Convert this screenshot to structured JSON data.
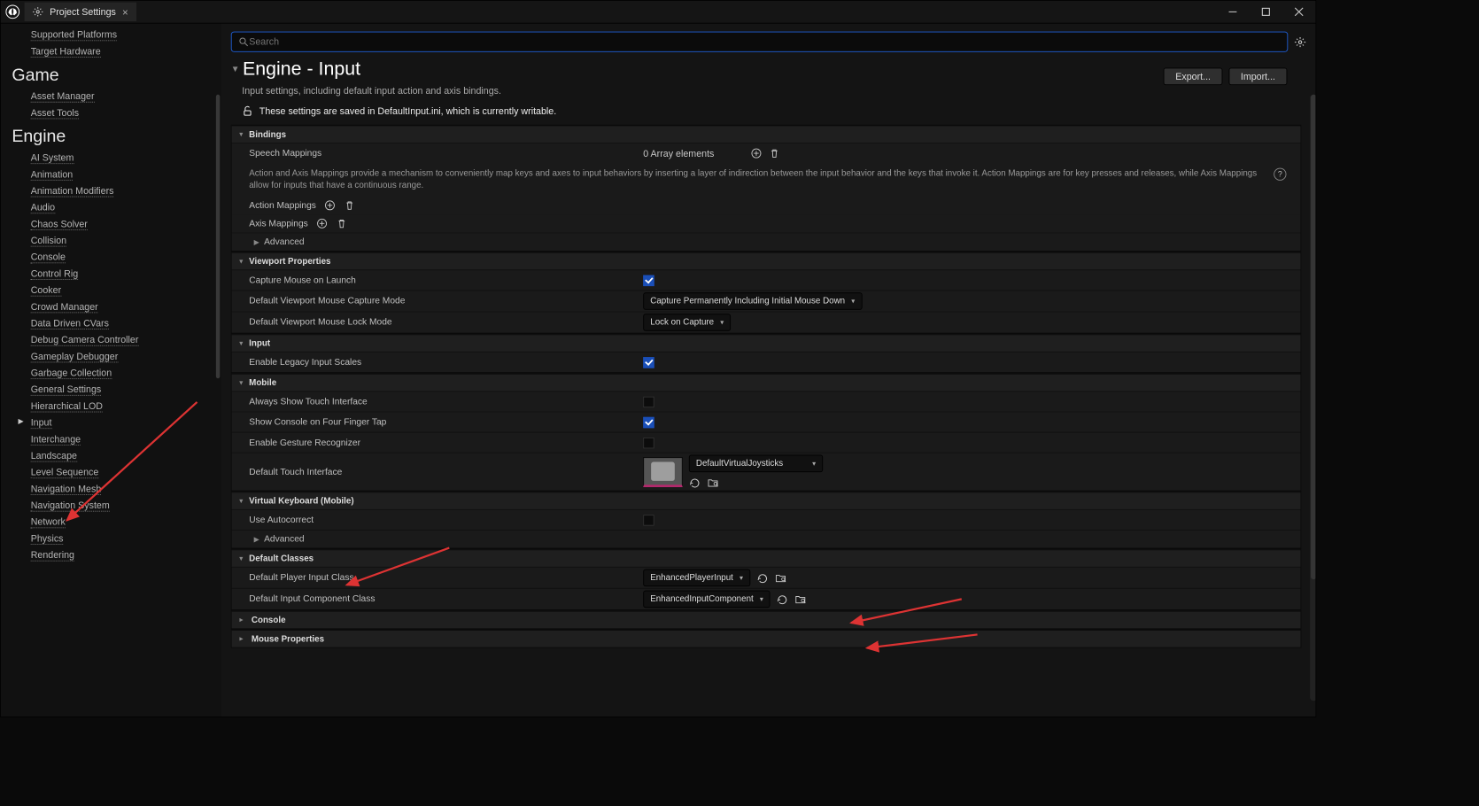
{
  "tab_title": "Project Settings",
  "search_placeholder": "Search",
  "page": {
    "title": "Engine - Input",
    "subtitle": "Input settings, including default input action and axis bindings.",
    "note": "These settings are saved in DefaultInput.ini, which is currently writable.",
    "export": "Export...",
    "import": "Import..."
  },
  "sidebar": {
    "top_items": [
      "Supported Platforms",
      "Target Hardware"
    ],
    "game_title": "Game",
    "game_items": [
      "Asset Manager",
      "Asset Tools"
    ],
    "engine_title": "Engine",
    "engine_items": [
      "AI System",
      "Animation",
      "Animation Modifiers",
      "Audio",
      "Chaos Solver",
      "Collision",
      "Console",
      "Control Rig",
      "Cooker",
      "Crowd Manager",
      "Data Driven CVars",
      "Debug Camera Controller",
      "Gameplay Debugger",
      "Garbage Collection",
      "General Settings",
      "Hierarchical LOD",
      "Input",
      "Interchange",
      "Landscape",
      "Level Sequence",
      "Navigation Mesh",
      "Navigation System",
      "Network",
      "Physics",
      "Rendering"
    ]
  },
  "bindings": {
    "header": "Bindings",
    "speech_label": "Speech Mappings",
    "speech_value": "0 Array elements",
    "help": "Action and Axis Mappings provide a mechanism to conveniently map keys and axes to input behaviors by inserting a layer of indirection between the input behavior and the keys that invoke it. Action Mappings are for key presses and releases, while Axis Mappings allow for inputs that have a continuous range.",
    "action_mappings": "Action Mappings",
    "axis_mappings": "Axis Mappings",
    "advanced": "Advanced"
  },
  "viewport": {
    "header": "Viewport Properties",
    "capture_mouse": "Capture Mouse on Launch",
    "capture_mode": "Default Viewport Mouse Capture Mode",
    "capture_mode_val": "Capture Permanently Including Initial Mouse Down",
    "lock_mode": "Default Viewport Mouse Lock Mode",
    "lock_mode_val": "Lock on Capture"
  },
  "input": {
    "header": "Input",
    "legacy": "Enable Legacy Input Scales"
  },
  "mobile": {
    "header": "Mobile",
    "always_touch": "Always Show Touch Interface",
    "four_finger": "Show Console on Four Finger Tap",
    "gesture": "Enable Gesture Recognizer",
    "touch_iface": "Default Touch Interface",
    "touch_iface_val": "DefaultVirtualJoysticks"
  },
  "vk": {
    "header": "Virtual Keyboard (Mobile)",
    "autocorrect": "Use Autocorrect",
    "advanced": "Advanced"
  },
  "defclasses": {
    "header": "Default Classes",
    "player": "Default Player Input Class",
    "player_val": "EnhancedPlayerInput",
    "comp": "Default Input Component Class",
    "comp_val": "EnhancedInputComponent"
  },
  "console_header": "Console",
  "mouse_header": "Mouse Properties"
}
